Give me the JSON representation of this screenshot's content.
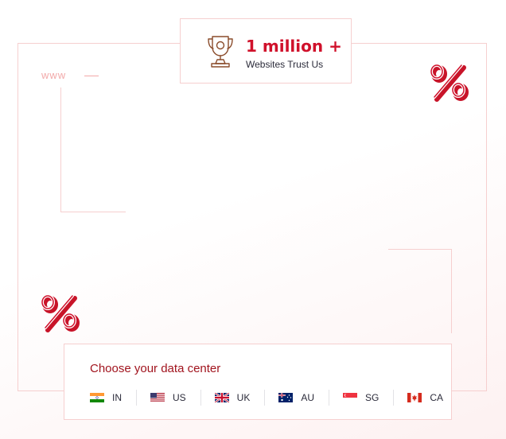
{
  "badge": {
    "count": "1 million +",
    "subtitle": "Websites Trust Us",
    "icon": "trophy-icon"
  },
  "decor": {
    "www_label": "www",
    "percent_icon": "percent-icon"
  },
  "datacenter": {
    "title": "Choose your data center",
    "options": [
      {
        "code": "IN",
        "flag": "india-flag-icon"
      },
      {
        "code": "US",
        "flag": "usa-flag-icon"
      },
      {
        "code": "UK",
        "flag": "uk-flag-icon"
      },
      {
        "code": "AU",
        "flag": "australia-flag-icon"
      },
      {
        "code": "SG",
        "flag": "singapore-flag-icon"
      },
      {
        "code": "CA",
        "flag": "canada-flag-icon"
      }
    ]
  },
  "colors": {
    "accent": "#d0112b",
    "border": "#f6cfcf",
    "text": "#2b2b3a",
    "title": "#a1141e"
  }
}
